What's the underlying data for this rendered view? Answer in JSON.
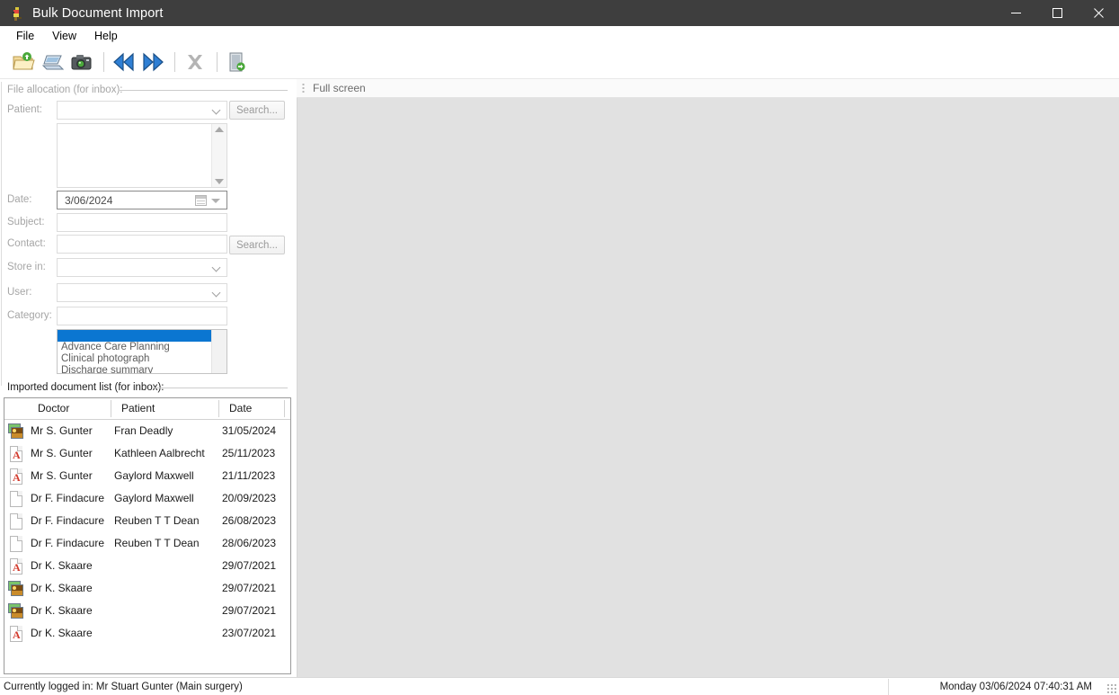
{
  "window": {
    "title": "Bulk Document Import",
    "icon": "bird-logo-icon",
    "controls": {
      "minimize": "minimize-icon",
      "maximize": "maximize-icon",
      "close": "close-icon"
    }
  },
  "menubar": {
    "items": [
      {
        "label": "File"
      },
      {
        "label": "View"
      },
      {
        "label": "Help"
      }
    ]
  },
  "toolbar": {
    "buttons": [
      {
        "icon": "open-folder-icon",
        "enabled": true
      },
      {
        "icon": "scanner-icon",
        "enabled": true
      },
      {
        "icon": "camera-icon",
        "enabled": true
      },
      {
        "icon": "rewind-icon",
        "enabled": true
      },
      {
        "icon": "fast-forward-icon",
        "enabled": true
      },
      {
        "icon": "delete-x-icon",
        "enabled": false
      },
      {
        "icon": "exit-door-icon",
        "enabled": true
      }
    ]
  },
  "file_allocation": {
    "group_label": "File allocation (for inbox):",
    "patient": {
      "label": "Patient:",
      "value": "",
      "placeholder": "",
      "search_label": "Search..."
    },
    "patient_results": [],
    "date": {
      "label": "Date:",
      "value": "3/06/2024"
    },
    "subject": {
      "label": "Subject:",
      "value": ""
    },
    "contact": {
      "label": "Contact:",
      "value": "",
      "search_label": "Search..."
    },
    "store_in": {
      "label": "Store in:",
      "value": ""
    },
    "user": {
      "label": "User:",
      "value": ""
    },
    "category": {
      "label": "Category:",
      "value": "",
      "options": [
        "",
        "Advance Care Planning",
        "Clinical photograph",
        "Discharge summary"
      ],
      "selected_index": 0
    }
  },
  "imported_list": {
    "group_label": "Imported document list (for inbox):",
    "columns": [
      "Doctor",
      "Patient",
      "Date"
    ],
    "rows": [
      {
        "icon": "image-file-icon",
        "doctor": "Mr S. Gunter",
        "patient": "Fran Deadly",
        "date": "31/05/2024"
      },
      {
        "icon": "pdf-file-icon",
        "doctor": "Mr S. Gunter",
        "patient": "Kathleen Aalbrecht",
        "date": "25/11/2023"
      },
      {
        "icon": "pdf-file-icon",
        "doctor": "Mr S. Gunter",
        "patient": "Gaylord Maxwell",
        "date": "21/11/2023"
      },
      {
        "icon": "blank-file-icon",
        "doctor": "Dr F. Findacure",
        "patient": "Gaylord Maxwell",
        "date": "20/09/2023"
      },
      {
        "icon": "blank-file-icon",
        "doctor": "Dr F. Findacure",
        "patient": "Reuben T T Dean",
        "date": "26/08/2023"
      },
      {
        "icon": "blank-file-icon",
        "doctor": "Dr F. Findacure",
        "patient": "Reuben T T Dean",
        "date": "28/06/2023"
      },
      {
        "icon": "pdf-file-icon",
        "doctor": "Dr K. Skaare",
        "patient": "",
        "date": "29/07/2021"
      },
      {
        "icon": "image-file-icon",
        "doctor": "Dr K. Skaare",
        "patient": "",
        "date": "29/07/2021"
      },
      {
        "icon": "image-file-icon",
        "doctor": "Dr K. Skaare",
        "patient": "",
        "date": "29/07/2021"
      },
      {
        "icon": "pdf-file-icon",
        "doctor": "Dr K. Skaare",
        "patient": "",
        "date": "23/07/2021"
      }
    ]
  },
  "preview": {
    "fullscreen_label": "Full screen"
  },
  "statusbar": {
    "logged_in": "Currently logged in:  Mr Stuart Gunter (Main surgery)",
    "datetime": "Monday 03/06/2024 07:40:31 AM"
  },
  "colors": {
    "titlebar": "#3e3e3e",
    "selection": "#0b76d1",
    "viewer_bg": "#e1e1e1",
    "pdf_red": "#d23b2e"
  }
}
